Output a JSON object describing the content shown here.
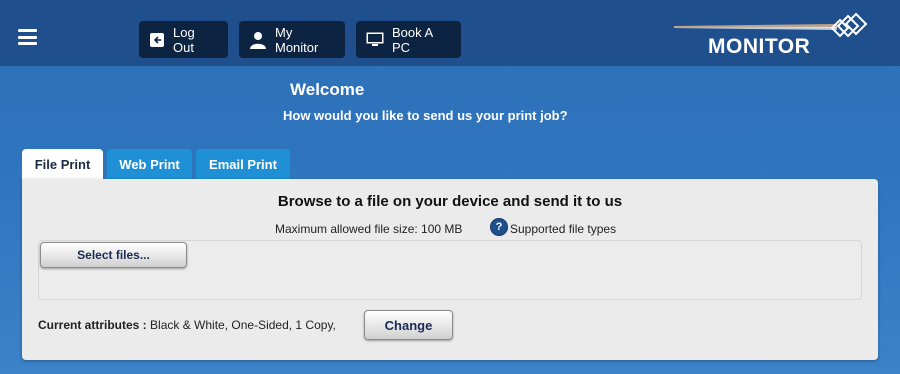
{
  "nav": {
    "logout_label": "Log Out",
    "my_monitor_label": "My Monitor",
    "book_pc_label": "Book A PC",
    "logo_text": "MONITOR"
  },
  "header": {
    "welcome": "Welcome",
    "subtitle": "How would you like to send us your print job?"
  },
  "tabs": [
    {
      "label": "File Print",
      "active": true
    },
    {
      "label": "Web Print",
      "active": false
    },
    {
      "label": "Email Print",
      "active": false
    }
  ],
  "panel": {
    "title": "Browse to a file on your device and send it to us",
    "max_size": "Maximum allowed file size: 100 MB",
    "supported_types": "Supported file types",
    "help_glyph": "?",
    "select_files_label": "Select files...",
    "attributes_label": "Current attributes :",
    "attributes_value": "Black & White, One-Sided, 1 Copy,",
    "change_label": "Change"
  },
  "colors": {
    "topbar": "#1f4f8d",
    "nav_button": "#0d2342",
    "active_tab": "#ffffff",
    "inactive_tab": "#1f8fd6",
    "panel": "#ebebeb"
  }
}
